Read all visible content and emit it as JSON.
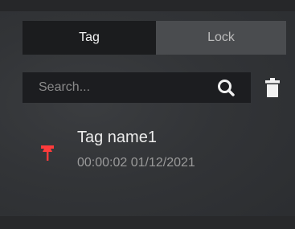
{
  "tabs": [
    {
      "label": "Tag",
      "active": true
    },
    {
      "label": "Lock",
      "active": false
    }
  ],
  "search": {
    "placeholder": "Search...",
    "value": ""
  },
  "tag_list": [
    {
      "name": "Tag name1",
      "time": "00:00:02",
      "date": "01/12/2021",
      "icon": "pin-icon"
    }
  ],
  "colors": {
    "accent_pin": "#ff3b3b",
    "active_tab": "#1b1c1e",
    "inactive_tab": "#4a4c4f"
  },
  "icons": {
    "search": "search-icon",
    "delete": "trash-icon"
  }
}
